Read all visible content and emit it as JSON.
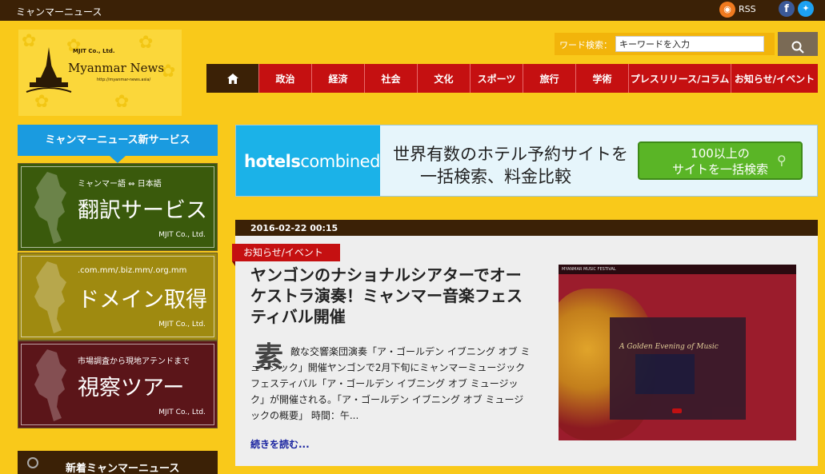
{
  "topbar": {
    "site_title": "ミャンマーニュース",
    "rss_label": "RSS",
    "icons": [
      "rss-icon",
      "facebook-icon",
      "twitter-icon"
    ]
  },
  "logo": {
    "company": "MJIT Co., Ltd.",
    "name": "Myanmar News",
    "url": "http://myanmar-news.asia/"
  },
  "search": {
    "label": "ワード検索：",
    "placeholder": "キーワードを入力",
    "button_icon": "search-icon"
  },
  "nav": {
    "home_icon": "home-icon",
    "items": [
      "政治",
      "経済",
      "社会",
      "文化",
      "スポーツ",
      "旅行",
      "学術",
      "プレスリリース/コラム",
      "お知らせ/イベント"
    ]
  },
  "sidebar": {
    "service_header": "ミャンマーニュース新サービス",
    "banners": [
      {
        "sub": "ミャンマー語 ⇔ 日本語",
        "main": "翻訳サービス",
        "company": "MJIT Co., Ltd."
      },
      {
        "sub": ".com.mm/.biz.mm/.org.mm",
        "main": "ドメイン取得",
        "company": "MJIT Co., Ltd."
      },
      {
        "sub": "市場調査から現地アテンドまで",
        "main": "視察ツアー",
        "company": "MJIT Co., Ltd."
      }
    ],
    "news_header": "新着ミャンマーニュース"
  },
  "ad": {
    "logo_bold": "hotels",
    "logo_thin": "combined",
    "headline_1": "世界有数のホテル予約サイトを",
    "headline_2": "一括検索、料金比較",
    "cta_1": "100以上の",
    "cta_2": "サイトを一括検索"
  },
  "article": {
    "date": "2016-02-22 00:15",
    "category": "お知らせ/イベント",
    "title": "ヤンゴンのナショナルシアターでオーケストラ演奏！ミャンマー音楽フェスティバル開催",
    "dropcap": "素",
    "excerpt": "敵な交響楽団演奏「ア・ゴールデン イブニング オブ ミュージック」開催ヤンゴンで2月下旬にミャンマーミュージック フェスティバル「ア・ゴールデン イブニング オブ ミュージック」が開催される。「ア・ゴールデン イブニング オブ ミュージックの概要」 時間：午...",
    "read_more": "続きを読む...",
    "image": {
      "nav_text": "MYANMAR MUSIC FESTIVAL",
      "poster_title": "A Golden Evening of Music"
    }
  }
}
